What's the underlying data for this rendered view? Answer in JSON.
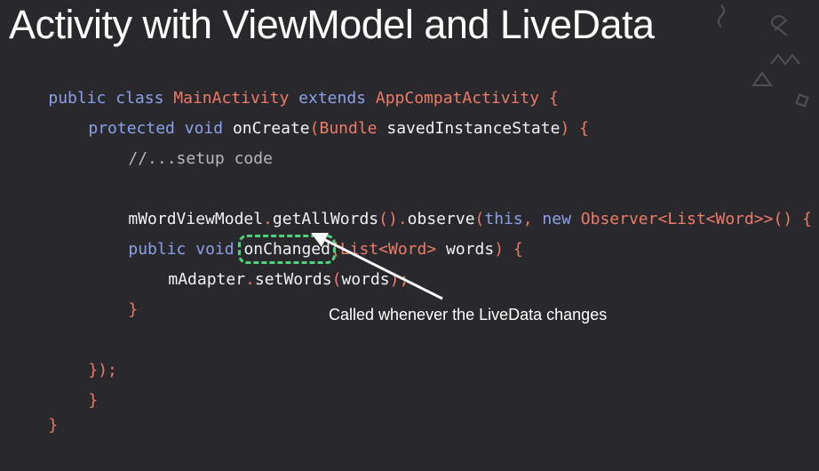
{
  "title": "Activity with ViewModel and LiveData",
  "code": {
    "l1": [
      "public",
      " ",
      "class",
      " ",
      "MainActivity",
      " ",
      "extends",
      " ",
      "AppCompatActivity",
      " ",
      "{"
    ],
    "l2": [
      "protected",
      " ",
      "void",
      " ",
      "onCreate",
      "(",
      "Bundle",
      " ",
      "savedInstanceState",
      ")",
      " ",
      "{"
    ],
    "l3": [
      "//...setup code"
    ],
    "l4": [
      "mWordViewModel",
      ".",
      "getAllWords",
      "()",
      ".",
      "observe",
      "(",
      "this",
      ",",
      " ",
      "new",
      " ",
      "Observer<List<Word>>",
      "()",
      " ",
      "{"
    ],
    "l5": [
      "public",
      " ",
      "void",
      " ",
      "onChanged",
      "(",
      "List<Word>",
      " ",
      "words",
      ")",
      " ",
      "{"
    ],
    "l6": [
      "mAdapter",
      ".",
      "setWords",
      "(",
      "words",
      ");"
    ],
    "l7": [
      "}"
    ],
    "l8": [
      "});"
    ],
    "l9": [
      "}"
    ],
    "l10": [
      "}"
    ]
  },
  "callout": "Called whenever the LiveData changes",
  "colors": {
    "background": "#29292d",
    "keyword": "#8ba0e8",
    "type": "#ee7a68",
    "identifier": "#f2f2f2",
    "highlight": "#4fd27c"
  }
}
